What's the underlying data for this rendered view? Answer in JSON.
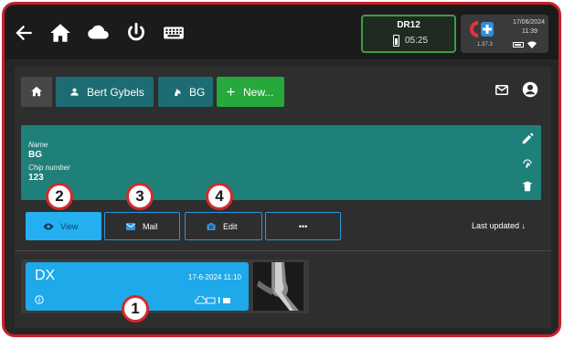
{
  "topbar": {
    "icons": [
      "back-arrow-icon",
      "home-icon",
      "cloud-icon",
      "power-icon",
      "keyboard-icon"
    ],
    "device": {
      "name": "DR12",
      "time": "05:25"
    },
    "system": {
      "date": "17/06/2024",
      "time": "11:39",
      "version": "1.37.3"
    }
  },
  "nav": {
    "home_icon": "home-icon",
    "breadcrumbs": [
      {
        "label": "Bert Gybels",
        "icon": "person-icon"
      },
      {
        "label": "BG",
        "icon": "horse-head-icon"
      }
    ],
    "new_label": "New..."
  },
  "card": {
    "name_label": "Name",
    "name_value": "BG",
    "chip_label": "Chip number",
    "chip_value": "123",
    "actions": [
      "edit-pencil-icon",
      "horse-badge-icon",
      "delete-trash-icon"
    ]
  },
  "actions": {
    "view_label": "View",
    "mail_label": "Mail",
    "edit_label": "Edit",
    "more_label": "•••"
  },
  "sort": {
    "label": "Last updated ↓"
  },
  "results": [
    {
      "type": "DX",
      "datetime": "17-6-2024 11:10"
    }
  ],
  "callouts": [
    "1",
    "2",
    "3",
    "4"
  ],
  "colors": {
    "frame_border": "#c8202a",
    "teal": "#1e8078",
    "breadcrumb": "#1e6c73",
    "new_green": "#26a83c",
    "accent_blue": "#24b0f0",
    "callout_red": "#d42a2a"
  }
}
